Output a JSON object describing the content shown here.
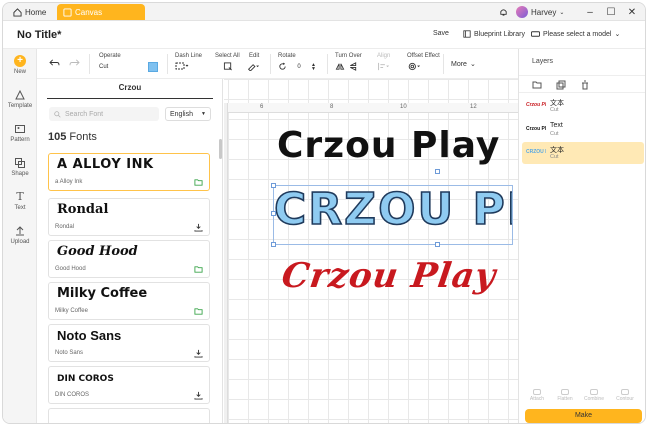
{
  "titlebar": {
    "tabs": [
      {
        "label": "Home",
        "icon": "home-icon"
      },
      {
        "label": "Canvas",
        "icon": "canvas-icon",
        "active": true
      }
    ],
    "user": "Harvey",
    "window_controls": [
      "minimize",
      "maximize",
      "close"
    ]
  },
  "header": {
    "title": "No Title*",
    "save_label": "Save",
    "library_label": "Blueprint Library",
    "model_label": "Please select a model"
  },
  "rail": {
    "items": [
      {
        "label": "New",
        "icon": "plus-icon"
      },
      {
        "label": "Template",
        "icon": "template-icon"
      },
      {
        "label": "Pattern",
        "icon": "pattern-icon"
      },
      {
        "label": "Shape",
        "icon": "shape-icon"
      },
      {
        "label": "Text",
        "icon": "text-icon"
      },
      {
        "label": "Upload",
        "icon": "upload-icon"
      }
    ]
  },
  "toolbar": {
    "operate_label": "Operate",
    "operate_value": "Cut",
    "dash_label": "Dash Line",
    "selectall_label": "Select All",
    "edit_label": "Edit",
    "rotate_label": "Rotate",
    "rotate_value": "0",
    "turnover_label": "Turn Over",
    "align_label": "Align",
    "offset_label": "Offset Effect",
    "more_label": "More",
    "colors": {
      "fill": "#7fc1f0",
      "accent": "#ffb51e"
    }
  },
  "font_panel": {
    "tab_label": "Crzou",
    "search_placeholder": "Search Font",
    "language": "English",
    "count": "105",
    "count_suffix": " Fonts",
    "fonts": [
      {
        "preview": "A ALLOY INK",
        "name": "a Alloy Ink",
        "action": "folder-icon",
        "selected": true
      },
      {
        "preview": "Rondal",
        "name": "Rondal",
        "action": "download-icon"
      },
      {
        "preview": "Good Hood",
        "name": "Good Hood",
        "action": "folder-icon"
      },
      {
        "preview": "Milky Coffee",
        "name": "Milky Coffee",
        "action": "folder-icon"
      },
      {
        "preview": "Noto Sans",
        "name": "Noto Sans",
        "action": "download-icon"
      },
      {
        "preview": "DIN COROS",
        "name": "DIN COROS",
        "action": "download-icon"
      }
    ]
  },
  "canvas": {
    "ruler_marks": [
      "6",
      "8",
      "10",
      "12"
    ],
    "texts": [
      {
        "text": "Crzou Play",
        "color": "#111111"
      },
      {
        "text": "CRZOU PLAY",
        "color": "#8fcbf1"
      },
      {
        "text": "Crzou Play",
        "color": "#c8191f"
      }
    ]
  },
  "layers": {
    "title": "Layers",
    "items": [
      {
        "name": "文本",
        "sub": "Cut",
        "thumb": "Crzou Play",
        "thumb_color": "#c8191f"
      },
      {
        "name": "Text",
        "sub": "Cut",
        "thumb": "Crzou Play",
        "thumb_color": "#111111"
      },
      {
        "name": "文本",
        "sub": "Cut",
        "thumb": "CRZOU PLAY",
        "thumb_color": "#7fc1f0",
        "selected": true
      }
    ],
    "bottom_tools": [
      "Attach",
      "Flatten",
      "Combine",
      "Contour"
    ],
    "make_label": "Make"
  }
}
